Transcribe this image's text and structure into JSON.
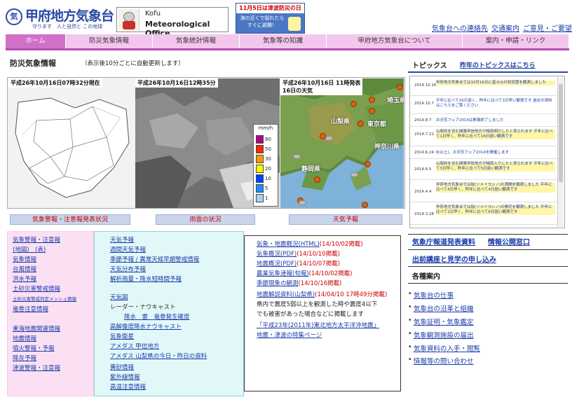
{
  "header": {
    "logo_mark": "気",
    "title": "甲府地方気象台",
    "tagline": "守ります　人と自然と この地球",
    "banner_kofu_line1": "Kofu",
    "banner_kofu_line2": "Meteorological Office",
    "tsunami_line1": "11月5日は津波防災の日",
    "tsunami_line2": "海の近くで揺れたら すぐに避難！",
    "links": [
      "気象台への連絡先",
      "交通案内",
      "ご意見・ご要望"
    ]
  },
  "nav": [
    "ホーム",
    "防災気象情報",
    "気象統計情報",
    "気象等の知識",
    "甲府地方気象台について",
    "案内・申請・リンク"
  ],
  "disaster": {
    "title": "防災気象情報",
    "subtitle": "（表示後10分ごとに自動更新します）",
    "map1_label": "平成26年10月16日07時32分現在",
    "map2_label": "平成26年10月16日12時35分",
    "map3_label_1": "平成26年10月16日 11時発表",
    "map3_label_2": "16日の天気",
    "legend_unit": "mm/h",
    "legend_levels": [
      "80",
      "50",
      "30",
      "20",
      "10",
      "5",
      "1"
    ],
    "btn1": "気象警報・注意報発表状況",
    "btn2": "雨雲の状況",
    "btn3": "天気予報",
    "prefs": [
      "山梨県",
      "東京都",
      "埼玉県",
      "神奈川県",
      "静岡県"
    ]
  },
  "left_links": [
    "気象警報・注意報",
    "(地図)　(表)",
    "気象情報",
    "台風情報",
    "洪水予報",
    "土砂災害警戒情報",
    "土砂災害警戒判定メッシュ情報",
    "竜巻注意情報",
    "東海地震関連情報",
    "地震情報",
    "噴火警報・予報",
    "降灰予報",
    "津波警報・注意報"
  ],
  "middle_links": [
    "天気予報",
    "週間天気予報",
    "季節予報 / 異常天候早期警戒情報",
    "天気分布予報",
    "解析雨量・降水短時間予報",
    "天気図",
    "レーダー・ナウキャスト",
    "降水　雷　竜巻発生確度",
    "高解像度降水ナウキャスト",
    "気象衛星",
    "アメダス 甲信地方",
    "アメダス 山梨県の今日・昨日の資料",
    "黄砂情報",
    "紫外線情報",
    "高温注意情報"
  ],
  "right_links": [
    {
      "text": "気象・地震概況(HTML)",
      "date": "(14/10/02掲載)"
    },
    {
      "text": "気象概況(PDF)",
      "date": "(14/10/10掲載)"
    },
    {
      "text": "地震概況(PDF)",
      "date": "(14/10/07掲載)"
    },
    {
      "text": "農業気象速報(旬報)",
      "date": "(14/10/02掲載)"
    },
    {
      "text": "季節現象の観測",
      "date": "(14/10/16掲載)"
    },
    {
      "text": "地震解説資料(山梨県)",
      "date": "(14/04/10 17時49分掲載)"
    },
    {
      "text": "県内で震度5弱以上を観測した時や震度4以下",
      "date": ""
    },
    {
      "text": "でも被害があった場合などに掲載します",
      "date": ""
    },
    {
      "text": "「平成23年(2011年)東北地方太平洋沖地震」",
      "date": ""
    },
    {
      "text": "地震・津波の特集ページ",
      "date": ""
    }
  ],
  "topics": {
    "title": "トピックス",
    "link": "昨年のトピックスはこちら",
    "items": [
      {
        "date": "2014.10.16",
        "text": "甲府地方気象台では10月16日に富士山の初冠雪を観測しました",
        "hl": true
      },
      {
        "date": "2014.10.7",
        "text": "平年に比べて16日遅く、昨年に比べて3日早い観測です 過去の資料はこちらをご覧ください",
        "hl": false
      },
      {
        "date": "2014.8.7",
        "text": "お天気フェア2014は無事終了しました",
        "hl": false
      },
      {
        "date": "2014.7.22",
        "text": "山梨県を含む関東甲信地方が梅雨明けしたと見られます 平年に比べて1日早く、昨年に比べて16日遅い観測です",
        "hl": true
      },
      {
        "date": "2014.6.24",
        "text": "8/2(土)、お天気フェア2014を開催します",
        "hl": false
      },
      {
        "date": "2014.6.5",
        "text": "山梨県を含む関東甲信地方が梅雨入りしたと見られます 平年に比べて3日早く、昨年に比べて5日遅い観測です",
        "hl": true
      },
      {
        "date": "2014.4.4",
        "text": "甲府地方気象台では桜(ソメイヨシノ)の満開を観測しました 平年に比べて4日早く、昨年に比べて4日遅い観測です",
        "hl": true
      },
      {
        "date": "2014.3.28",
        "text": "甲府地方気象台では桜(ソメイヨシノ)の開花を観測しました 平年に比べて1日早く、昨年に比べて6日遅い観測です",
        "hl": true
      }
    ]
  },
  "right_panel": {
    "l1": "気象庁報道発表資料",
    "l2": "情報公開窓口",
    "l3": "出前講座と見学の申し込み",
    "l4": "各種案内",
    "bullets": [
      "気象台の仕事",
      "気象台の沿革と組織",
      "気象証明・気象鑑定",
      "気象観測施設の届出",
      "気象資料の入手・閲覧",
      "情報等の問い合わせ"
    ]
  }
}
